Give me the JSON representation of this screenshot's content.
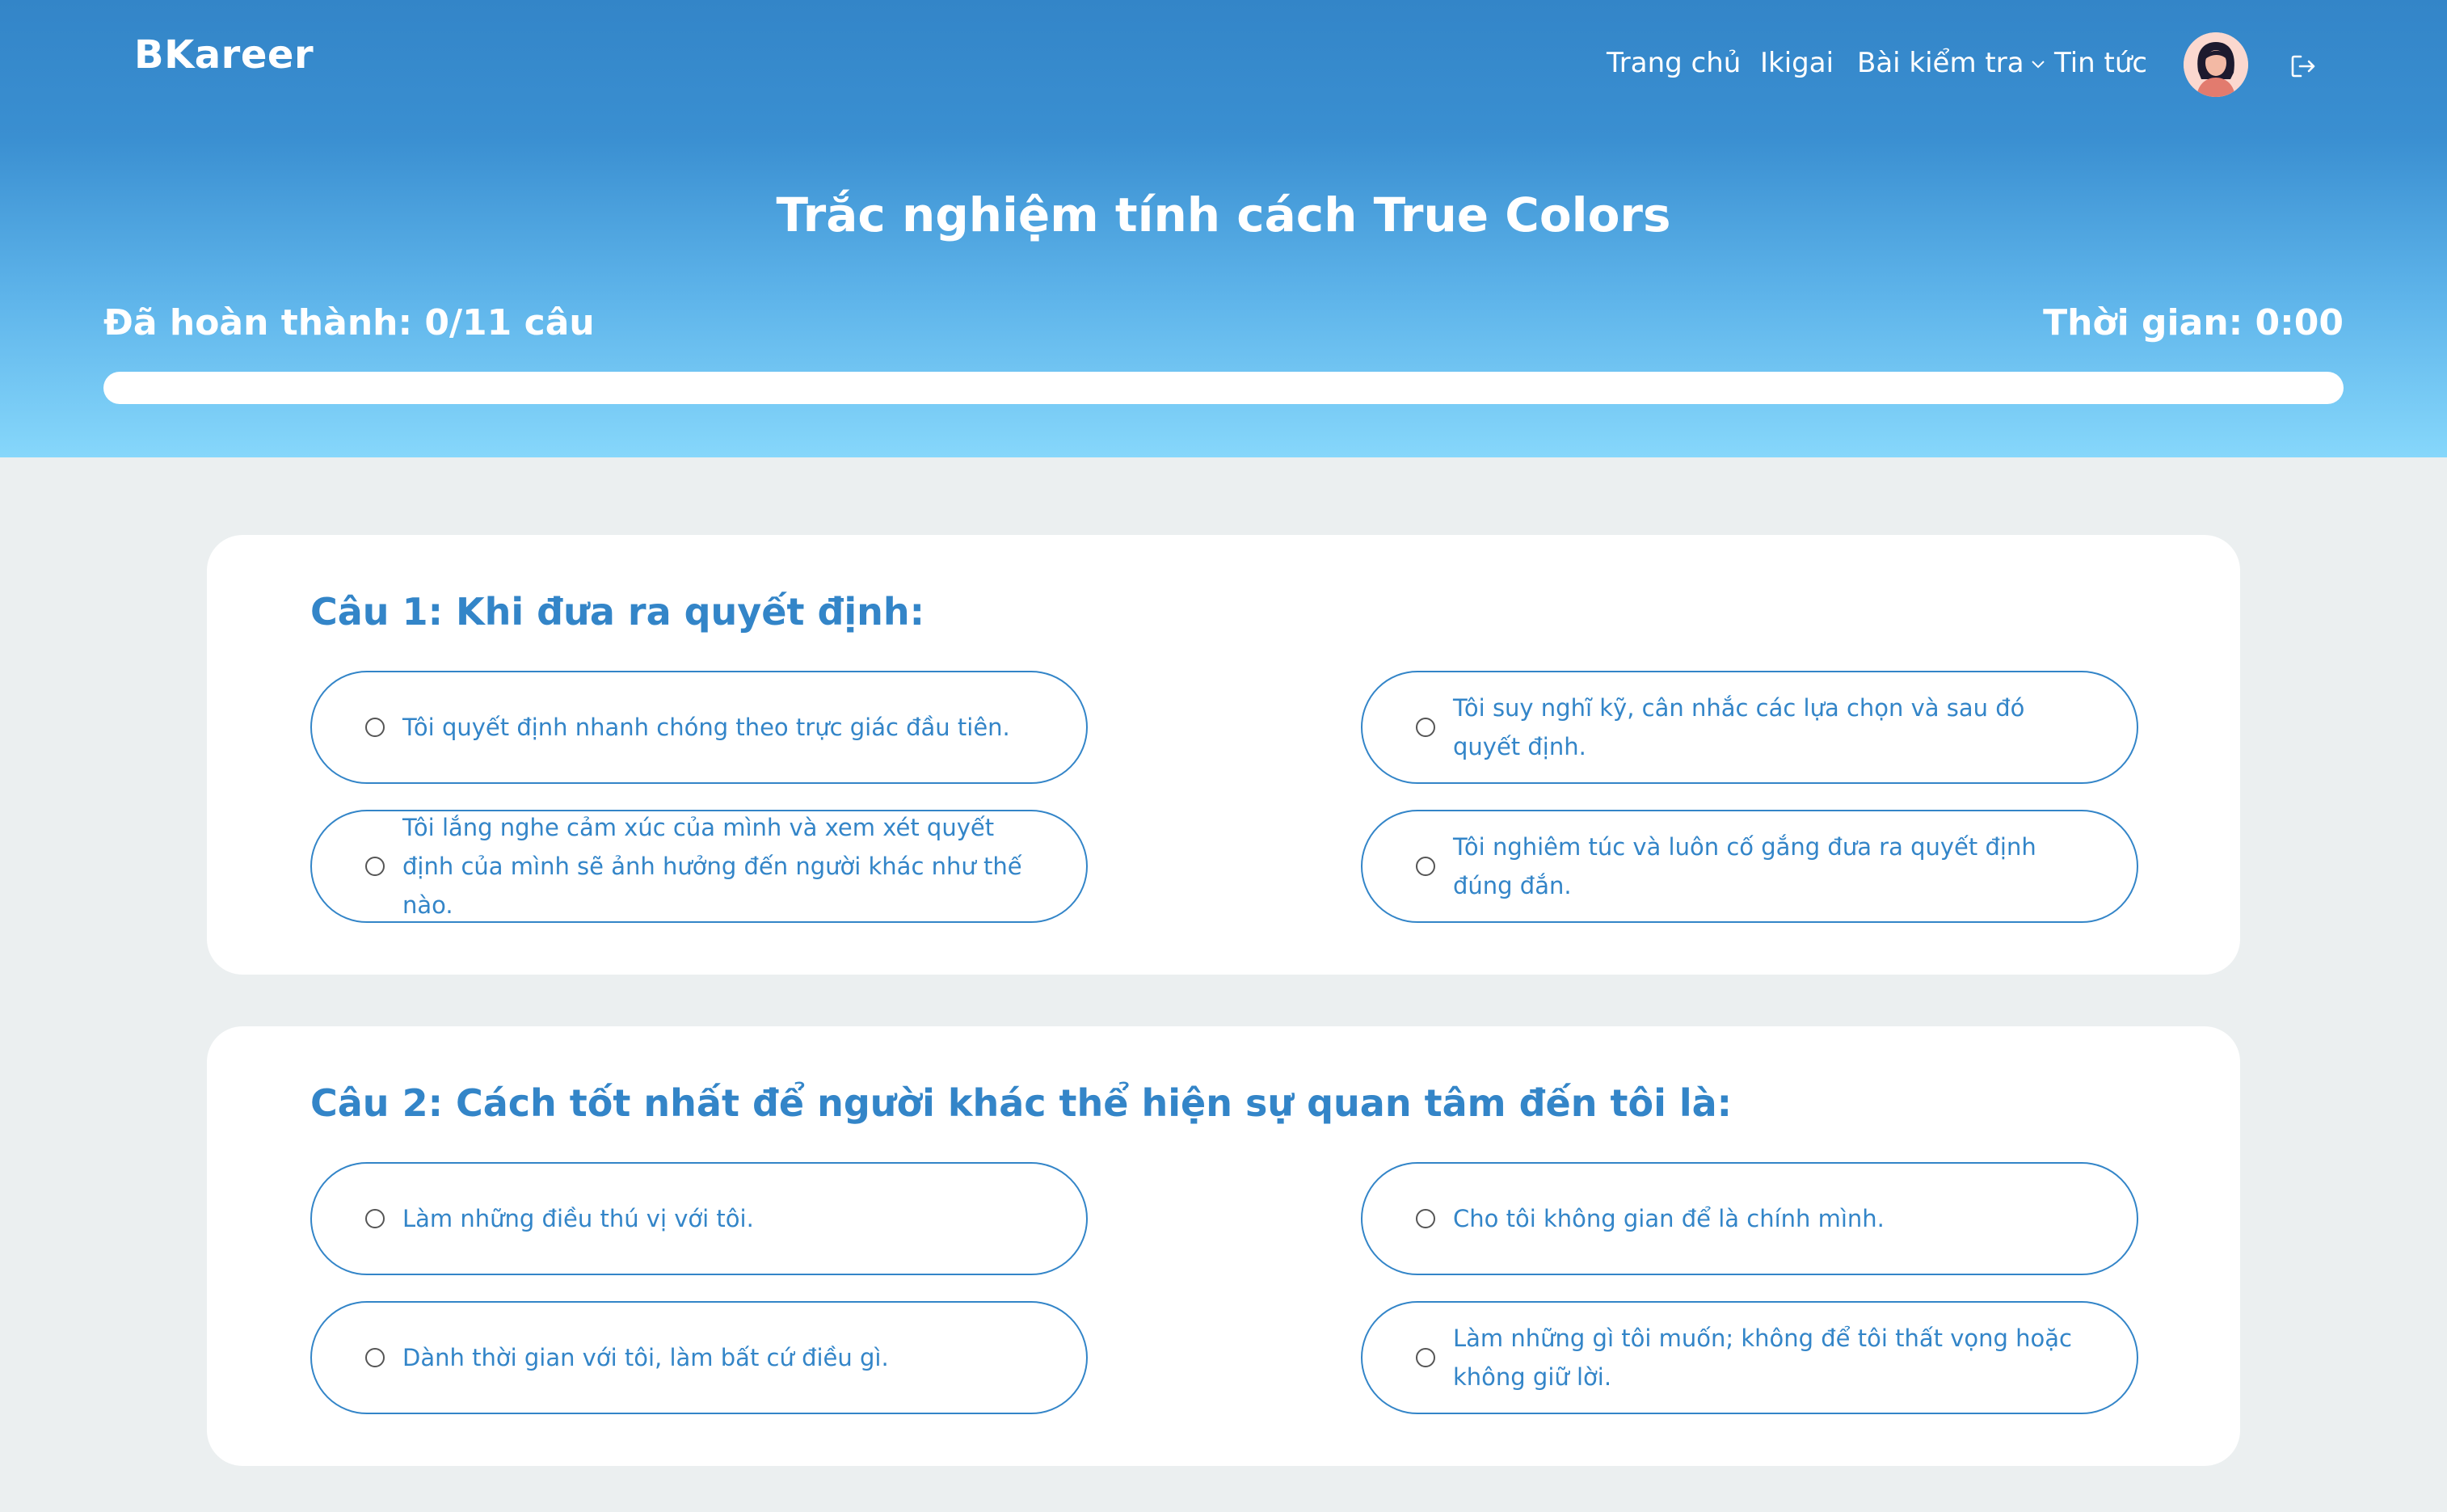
{
  "brand": "BKareer",
  "nav": {
    "home": "Trang chủ",
    "ikigai": "Ikigai",
    "tests": "Bài kiểm tra",
    "news": "Tin tức"
  },
  "icons": {
    "dropdown": "chevron-down-icon",
    "avatar": "user-avatar",
    "logout": "logout-icon"
  },
  "page_title": "Trắc nghiệm tính cách True Colors",
  "progress": {
    "label": "Đã hoàn thành: 0/11 câu",
    "completed": 0,
    "total": 11,
    "fraction": 0
  },
  "timer": "Thời gian: 0:00",
  "colors": {
    "accent": "#3385c8",
    "hero_top": "#3385c8",
    "hero_bottom": "#86d7fb",
    "background": "#ebeff0"
  },
  "questions": [
    {
      "title": "Câu 1: Khi đưa ra quyết định:",
      "options": [
        "Tôi quyết định nhanh chóng theo trực giác đầu tiên.",
        "Tôi suy nghĩ kỹ, cân nhắc các lựa chọn và sau đó quyết định.",
        "Tôi lắng nghe cảm xúc của mình và xem xét quyết định của mình sẽ ảnh hưởng đến người khác như thế nào.",
        "Tôi nghiêm túc và luôn cố gắng đưa ra quyết định đúng đắn."
      ]
    },
    {
      "title": "Câu 2: Cách tốt nhất để người khác thể hiện sự quan tâm đến tôi là:",
      "options": [
        "Làm những điều thú vị với tôi.",
        "Cho tôi không gian để là chính mình.",
        "Dành thời gian với tôi, làm bất cứ điều gì.",
        "Làm những gì tôi muốn; không để tôi thất vọng hoặc không giữ lời."
      ]
    }
  ]
}
